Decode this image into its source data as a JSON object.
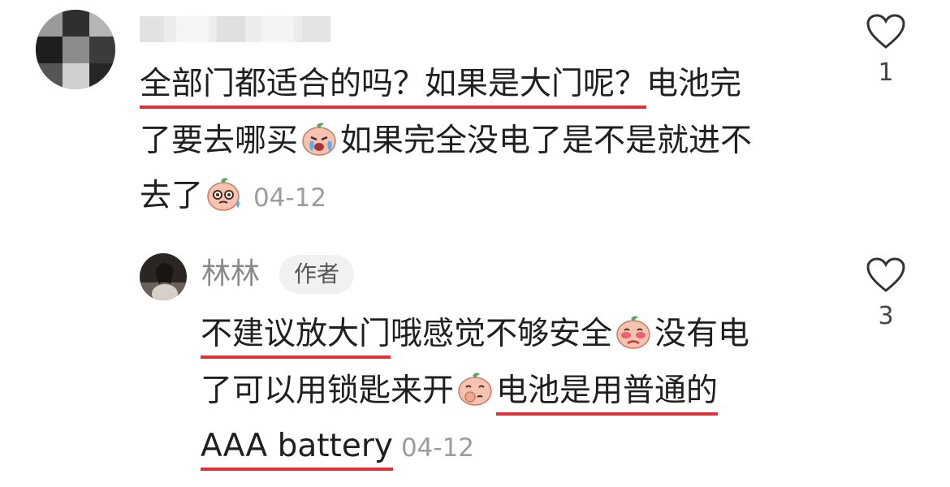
{
  "comment": {
    "lines": [
      {
        "u1": "全部门都适合的吗？",
        "u2": "如果是大门呢？",
        "rest": "电池完"
      },
      {
        "a": "了要去哪买",
        "b": "如果完全没电了是不是就进不"
      },
      {
        "a": "去了"
      }
    ],
    "date": "04-12",
    "likes": "1",
    "emoji1": "crying-emoji",
    "emoji2": "sweating-emoji"
  },
  "reply": {
    "author": "林林",
    "badge": "作者",
    "lines": [
      {
        "u1": "不建议放大门",
        "rest": "哦感觉不够安全",
        "tail": "没有电"
      },
      {
        "a": "了可以用锁匙来开",
        "u2": "电池是用普通的"
      },
      {
        "u3": "AAA battery"
      }
    ],
    "date": "04-12",
    "likes": "3",
    "emoji1": "blushing-emoji",
    "emoji2": "thinking-emoji"
  },
  "colors": {
    "underline": "#e0303a",
    "date": "#9c9c9c",
    "badge_bg": "#f1f1f1"
  }
}
